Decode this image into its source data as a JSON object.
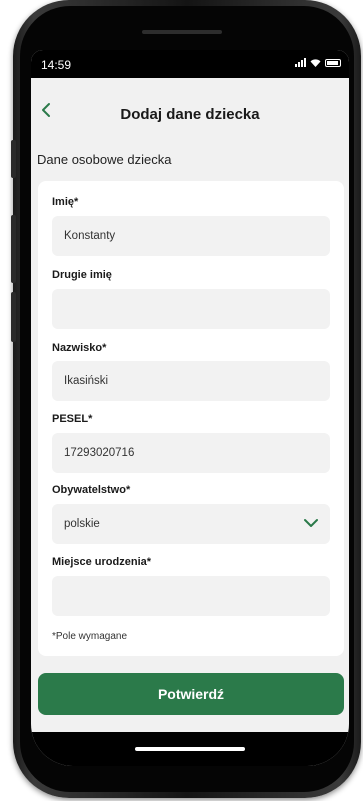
{
  "status_bar": {
    "time": "14:59"
  },
  "header": {
    "title": "Dodaj dane dziecka"
  },
  "section": {
    "title": "Dane osobowe dziecka"
  },
  "form": {
    "first_name": {
      "label": "Imię*",
      "value": "Konstanty"
    },
    "middle_name": {
      "label": "Drugie imię",
      "value": ""
    },
    "last_name": {
      "label": "Nazwisko*",
      "value": "Ikasiński"
    },
    "pesel": {
      "label": "PESEL*",
      "value": "17293020716"
    },
    "citizenship": {
      "label": "Obywatelstwo*",
      "value": "polskie"
    },
    "birthplace": {
      "label": "Miejsce urodzenia*",
      "value": ""
    },
    "required_note": "*Pole wymagane"
  },
  "actions": {
    "confirm_label": "Potwierdź"
  },
  "colors": {
    "accent": "#2b7a4a",
    "background": "#f1f1f1",
    "field": "#f2f2f2"
  }
}
